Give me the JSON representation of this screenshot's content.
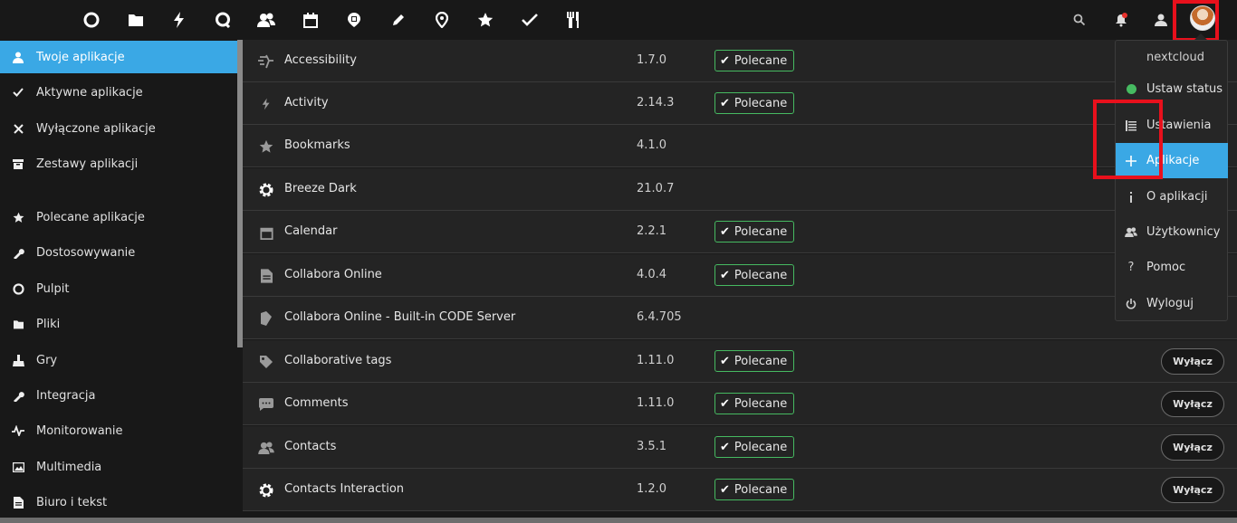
{
  "topnav": {
    "apps": [
      {
        "icon": "dashboard-icon",
        "label": "Pulpit"
      },
      {
        "icon": "files-icon",
        "label": "Pliki"
      },
      {
        "icon": "activity-icon",
        "label": "Aktywność"
      },
      {
        "icon": "talk-icon",
        "label": "Talk"
      },
      {
        "icon": "contacts-icon",
        "label": "Kontakty"
      },
      {
        "icon": "calendar-icon",
        "label": "Kalendarz"
      },
      {
        "icon": "notes-icon",
        "label": "Notatki"
      },
      {
        "icon": "pencil-icon",
        "label": "Edycja"
      },
      {
        "icon": "map-pin-icon",
        "label": "Mapy"
      },
      {
        "icon": "star-icon",
        "label": "Zakładki"
      },
      {
        "icon": "check-icon",
        "label": "Zadania"
      },
      {
        "icon": "cookbook-icon",
        "label": "Książka kucharska"
      }
    ],
    "right": [
      {
        "icon": "search-icon"
      },
      {
        "icon": "notifications-icon"
      },
      {
        "icon": "contacts-menu-icon"
      }
    ]
  },
  "sidebar": {
    "items": [
      {
        "label": "Twoje aplikacje",
        "icon": "user-icon",
        "active": true
      },
      {
        "label": "Aktywne aplikacje",
        "icon": "check-icon",
        "active": false
      },
      {
        "label": "Wyłączone aplikacje",
        "icon": "close-icon",
        "active": false
      },
      {
        "label": "Zestawy aplikacji",
        "icon": "bundle-icon",
        "active": false
      },
      {
        "label": "Polecane aplikacje",
        "icon": "star-icon",
        "active": false
      },
      {
        "label": "Dostosowywanie",
        "icon": "wrench-icon",
        "active": false
      },
      {
        "label": "Pulpit",
        "icon": "dashboard-icon",
        "active": false
      },
      {
        "label": "Pliki",
        "icon": "folder-icon",
        "active": false
      },
      {
        "label": "Gry",
        "icon": "games-icon",
        "active": false
      },
      {
        "label": "Integracja",
        "icon": "integration-icon",
        "active": false
      },
      {
        "label": "Monitorowanie",
        "icon": "monitoring-icon",
        "active": false
      },
      {
        "label": "Multimedia",
        "icon": "multimedia-icon",
        "active": false
      },
      {
        "label": "Biuro i tekst",
        "icon": "office-icon",
        "active": false
      }
    ]
  },
  "apps": [
    {
      "name": "Accessibility",
      "version": "1.7.0",
      "featured": true,
      "icon": "accessibility-icon",
      "action": ""
    },
    {
      "name": "Activity",
      "version": "2.14.3",
      "featured": true,
      "icon": "activity-icon",
      "action": ""
    },
    {
      "name": "Bookmarks",
      "version": "4.1.0",
      "featured": false,
      "icon": "star-icon",
      "action": ""
    },
    {
      "name": "Breeze Dark",
      "version": "21.0.7",
      "featured": false,
      "icon": "gear-icon",
      "action": ""
    },
    {
      "name": "Calendar",
      "version": "2.2.1",
      "featured": true,
      "icon": "calendar-icon",
      "action": ""
    },
    {
      "name": "Collabora Online",
      "version": "4.0.4",
      "featured": true,
      "icon": "document-icon",
      "action": ""
    },
    {
      "name": "Collabora Online - Built-in CODE Server",
      "version": "6.4.705",
      "featured": false,
      "icon": "code-server-icon",
      "action": ""
    },
    {
      "name": "Collaborative tags",
      "version": "1.11.0",
      "featured": true,
      "icon": "tag-icon",
      "action": "Wyłącz"
    },
    {
      "name": "Comments",
      "version": "1.11.0",
      "featured": true,
      "icon": "comment-icon",
      "action": "Wyłącz"
    },
    {
      "name": "Contacts",
      "version": "3.5.1",
      "featured": true,
      "icon": "contacts-icon",
      "action": "Wyłącz"
    },
    {
      "name": "Contacts Interaction",
      "version": "1.2.0",
      "featured": true,
      "icon": "gear-icon",
      "action": "Wyłącz"
    }
  ],
  "featured_label": "Polecane",
  "user_menu": {
    "username": "nextcloud",
    "items": [
      {
        "label": "Ustaw status",
        "icon": "status-dot-icon",
        "active": false
      },
      {
        "label": "Ustawienia",
        "icon": "settings-list-icon",
        "active": false
      },
      {
        "label": "Aplikacje",
        "icon": "plus-icon",
        "active": true
      },
      {
        "label": "O aplikacji",
        "icon": "info-icon",
        "active": false
      },
      {
        "label": "Użytkownicy",
        "icon": "users-icon",
        "active": false
      },
      {
        "label": "Pomoc",
        "icon": "help-icon",
        "active": false
      },
      {
        "label": "Wyloguj",
        "icon": "logout-icon",
        "active": false
      }
    ]
  },
  "colors": {
    "accent": "#3aa8e5",
    "featured": "#46ba61",
    "highlight": "#e8101c"
  }
}
